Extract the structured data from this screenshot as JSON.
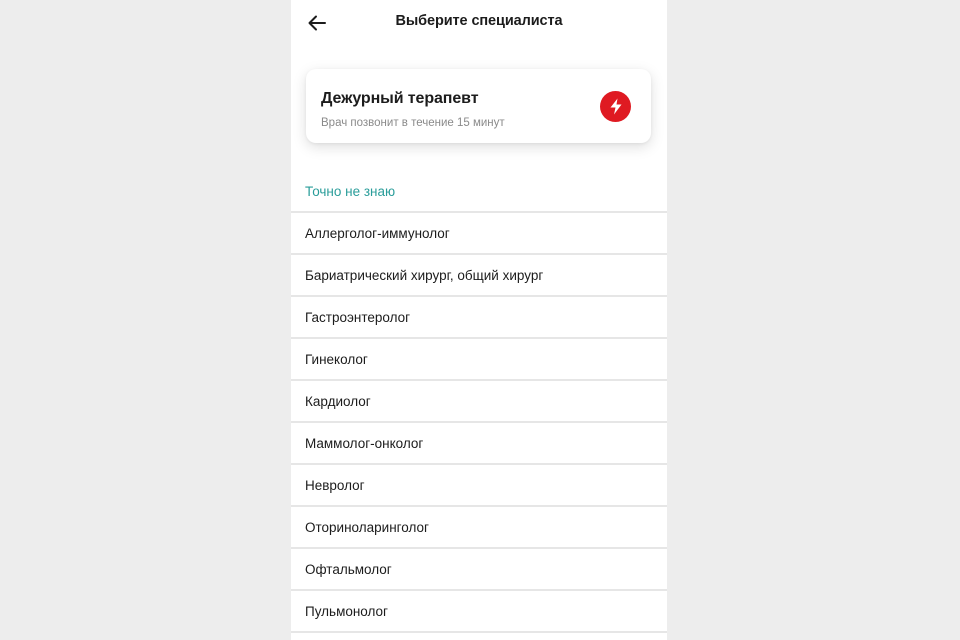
{
  "header": {
    "title": "Выберите специалиста",
    "back_icon": "arrow-left-icon"
  },
  "duty_card": {
    "title": "Дежурный терапевт",
    "subtitle": "Врач позвонит в течение 15 минут",
    "icon": "lightning-bolt-icon",
    "icon_color": "#df1a22"
  },
  "unsure_link": {
    "label": "Точно не знаю",
    "color": "#2a9d9a"
  },
  "specialists": [
    {
      "label": "Аллерголог-иммунолог"
    },
    {
      "label": "Бариатрический хирург, общий хирург"
    },
    {
      "label": "Гастроэнтеролог"
    },
    {
      "label": "Гинеколог"
    },
    {
      "label": "Кардиолог"
    },
    {
      "label": "Маммолог-онколог"
    },
    {
      "label": "Невролог"
    },
    {
      "label": "Оториноларинголог"
    },
    {
      "label": "Офтальмолог"
    },
    {
      "label": "Пульмонолог"
    }
  ]
}
